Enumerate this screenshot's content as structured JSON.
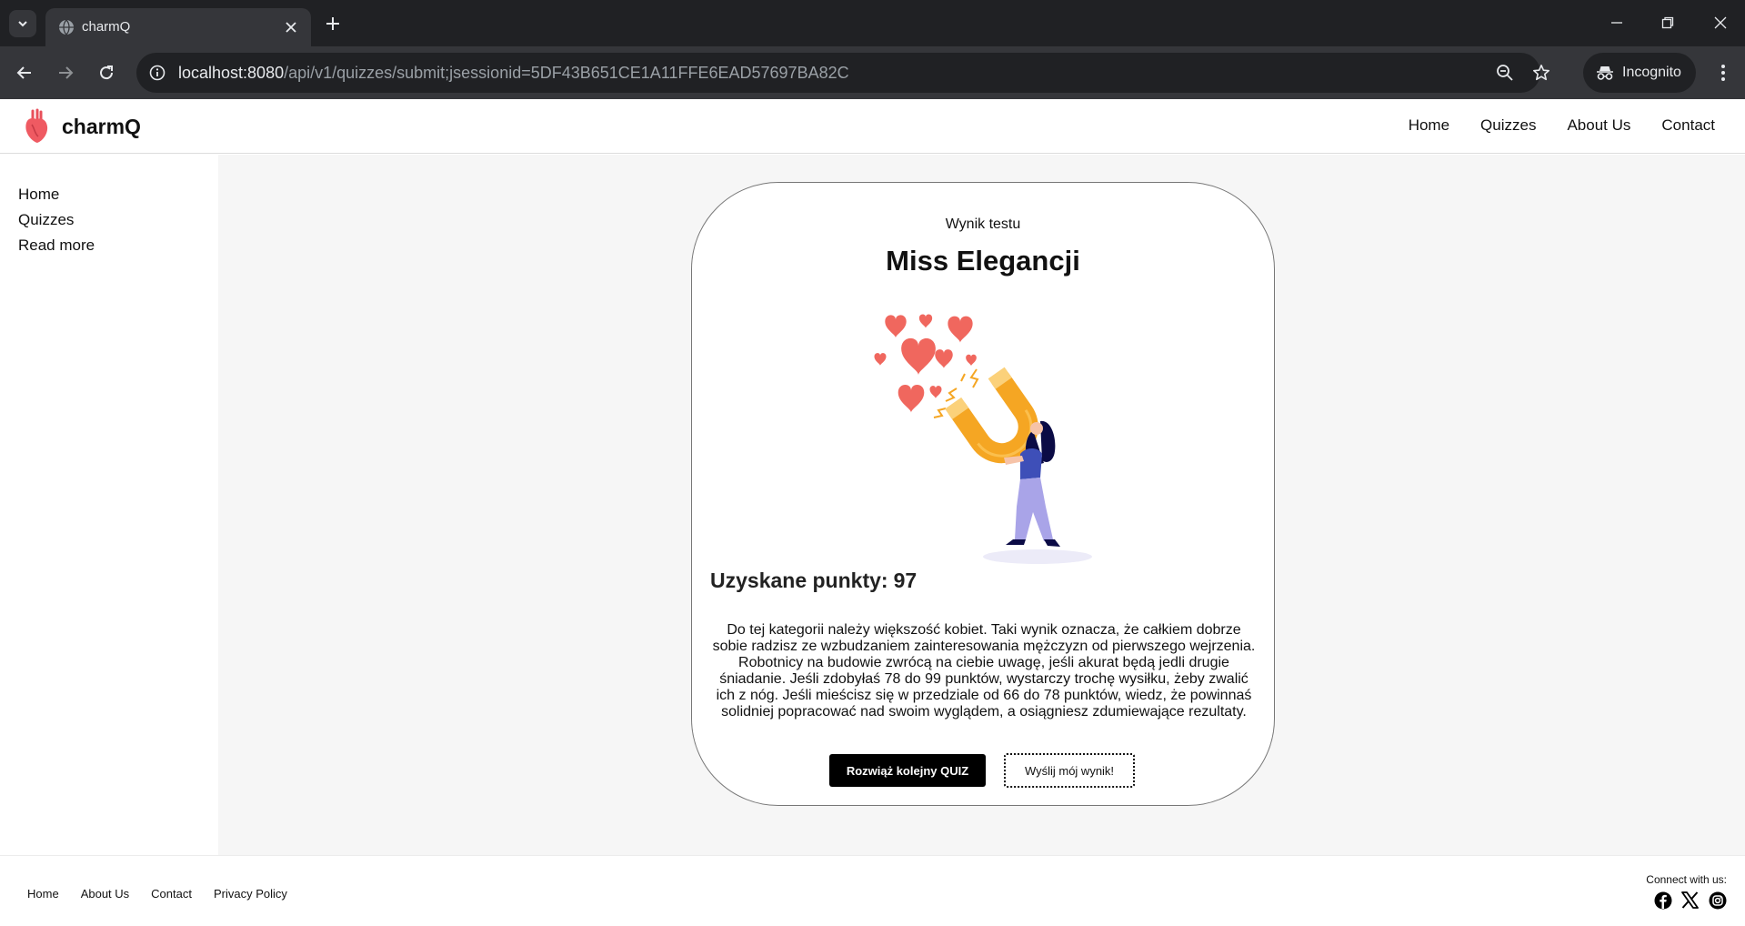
{
  "browser": {
    "tab_title": "charmQ",
    "url_host": "localhost:8080",
    "url_path": "/api/v1/quizzes/submit;jsessionid=5DF43B651CE1A11FFE6EAD57697BA82C",
    "incognito_label": "Incognito"
  },
  "header": {
    "brand": "charmQ",
    "nav": [
      "Home",
      "Quizzes",
      "About Us",
      "Contact"
    ]
  },
  "sidebar": {
    "items": [
      "Home",
      "Quizzes",
      "Read more"
    ]
  },
  "result": {
    "kicker": "Wynik testu",
    "title": "Miss Elegancji",
    "score_label": "Uzyskane punkty:",
    "score_value": "97",
    "description": "Do tej kategorii należy większość kobiet. Taki wynik oznacza, że całkiem dobrze sobie radzisz ze wzbudzaniem zainteresowania mężczyzn od pierwszego wejrzenia. Robotnicy na budowie zwrócą na ciebie uwagę, jeśli akurat będą jedli drugie śniadanie. Jeśli zdobyłaś 78 do 99 punktów, wystarczy trochę wysiłku, żeby zwalić ich z nóg. Jeśli mieścisz się w przedziale od 66 do 78 punktów, wiedz, że powinnaś solidniej popracować nad swoim wyglądem, a osiągniesz zdumiewające rezultaty.",
    "primary_button": "Rozwiąż kolejny QUIZ",
    "secondary_button": "Wyślij mój wynik!"
  },
  "footer": {
    "links": [
      "Home",
      "About Us",
      "Contact",
      "Privacy Policy"
    ],
    "connect_label": "Connect with us:",
    "socials": [
      "facebook-icon",
      "x-icon",
      "instagram-icon"
    ]
  },
  "colors": {
    "chrome_dark": "#202124",
    "chrome_toolbar": "#35363a",
    "heart": "#f0675e",
    "magnet": "#f5a623",
    "main_bg": "#f6f6f6"
  }
}
